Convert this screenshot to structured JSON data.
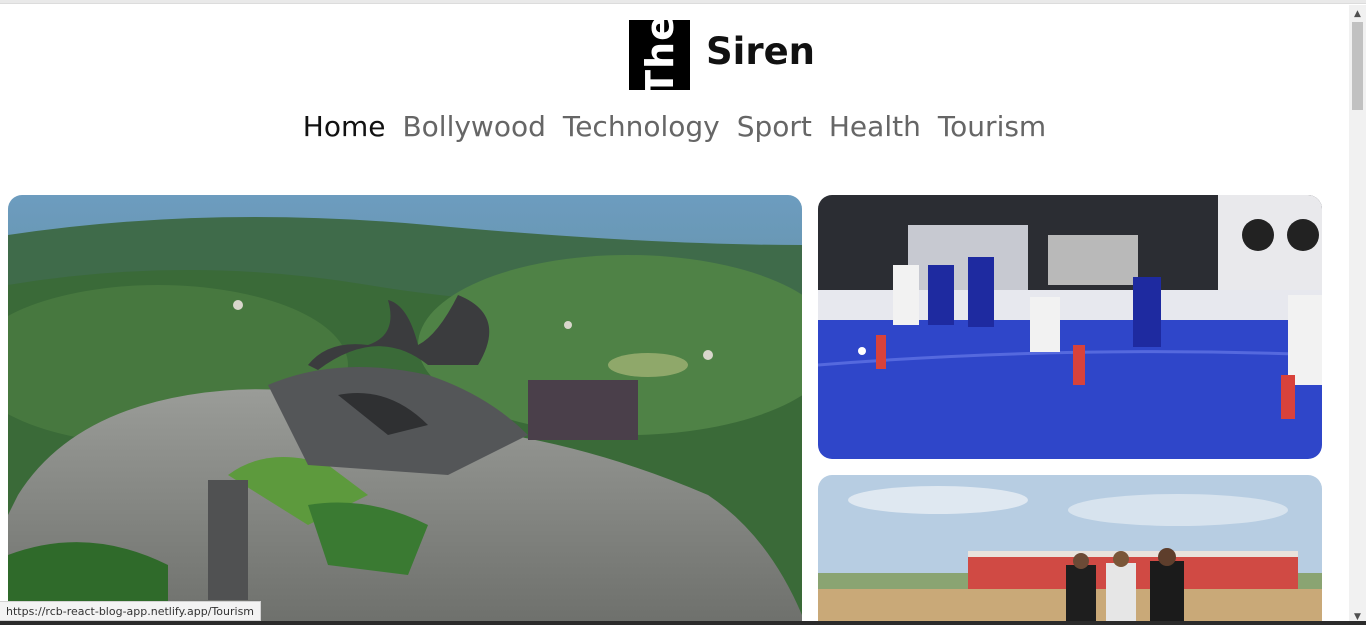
{
  "header": {
    "logo_text": "The",
    "site_title": "Siren"
  },
  "nav": {
    "items": [
      {
        "label": "Home",
        "active": true
      },
      {
        "label": "Bollywood",
        "active": false
      },
      {
        "label": "Technology",
        "active": false
      },
      {
        "label": "Sport",
        "active": false
      },
      {
        "label": "Health",
        "active": false
      },
      {
        "label": "Tourism",
        "active": false
      }
    ]
  },
  "featured": {
    "main_image": "eagle-sculpture-hilltop-photo",
    "side_top_image": "field-hockey-match-photo",
    "side_bottom_image": "group-outdoor-event-photo"
  },
  "status_bar": {
    "url": "https://rcb-react-blog-app.netlify.app/Tourism"
  },
  "colors": {
    "nav_active": "#111111",
    "nav_inactive": "#666666",
    "logo_bg": "#000000"
  }
}
